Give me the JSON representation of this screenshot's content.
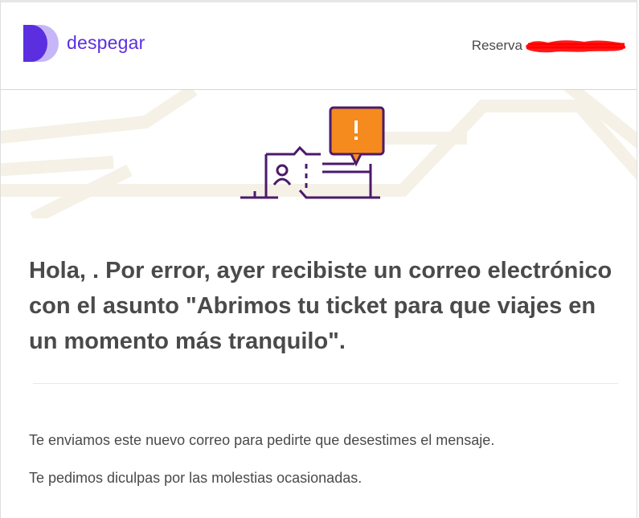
{
  "brand": {
    "name": "despegar",
    "primary_color": "#5b2ee0",
    "accent_color": "#b9a6f5"
  },
  "header": {
    "booking_label": "Reserva"
  },
  "illustration": {
    "icon": "ticket-alert-icon",
    "alert_color": "#f58a1f",
    "line_color": "#4b1a6b",
    "background_color": "#f5f1e6"
  },
  "message": {
    "headline": "Hola, . Por error, ayer recibiste un correo electrónico con el asunto \"Abrimos tu ticket para que viajes en un momento más tranquilo\".",
    "body_1": "Te enviamos este nuevo correo para pedirte que desestimes el mensaje.",
    "body_2": "Te pedimos diculpas por las molestias ocasionadas."
  }
}
